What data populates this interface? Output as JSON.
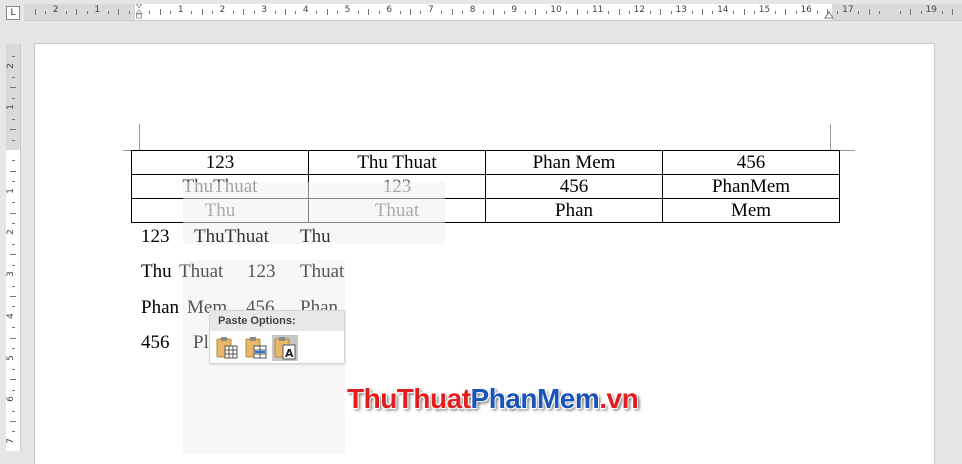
{
  "ruler": {
    "tab_selector": "L",
    "horizontal_numbers": [
      "2",
      "1",
      "1",
      "2",
      "3",
      "4",
      "5",
      "6",
      "7",
      "8",
      "9",
      "10",
      "11",
      "12",
      "13",
      "14",
      "15",
      "16",
      "17",
      "19"
    ],
    "vertical_numbers": [
      "2",
      "1",
      "1",
      "2",
      "3",
      "4",
      "5",
      "6",
      "7"
    ]
  },
  "table": {
    "rows": [
      [
        "123",
        "Thu Thuat",
        "Phan Mem",
        "456"
      ],
      [
        "ThuThuat",
        "123",
        "456",
        "PhanMem"
      ],
      [
        "Thu",
        "Thuat",
        "Phan",
        "Mem"
      ]
    ]
  },
  "paragraphs": [
    {
      "cells": [
        "123",
        "ThuThuat",
        "Thu"
      ]
    },
    {
      "cells": [
        "Thu",
        "Thuat",
        "123",
        "Thuat"
      ]
    },
    {
      "cells": [
        "Phan",
        "Mem",
        "456",
        "Phan"
      ]
    },
    {
      "cells": [
        "456",
        "Pl"
      ]
    }
  ],
  "paste_options": {
    "title": "Paste Options:",
    "buttons": [
      {
        "name": "keep-source-formatting",
        "icon": "clipboard-table-icon"
      },
      {
        "name": "merge-table",
        "icon": "clipboard-merge-table-icon"
      },
      {
        "name": "keep-text-only",
        "icon": "clipboard-text-icon"
      }
    ]
  },
  "watermark": {
    "part1": "ThuThuat",
    "part2": "PhanMem",
    "part3": ".vn"
  }
}
